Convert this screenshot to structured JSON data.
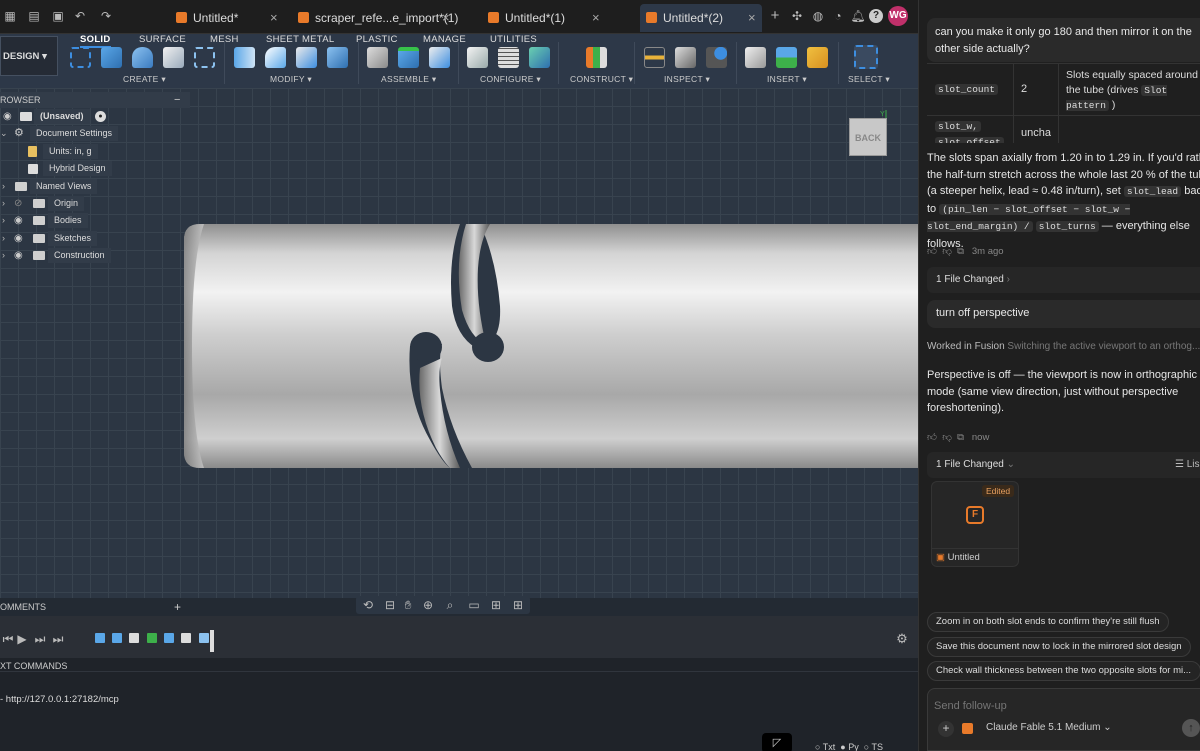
{
  "tabs": [
    {
      "label": "Untitled*"
    },
    {
      "label": "scraper_refe...e_import*(1)"
    },
    {
      "label": "Untitled*(1)"
    },
    {
      "label": "Untitled*(2)"
    }
  ],
  "user_initials": "WG",
  "ribbon": {
    "workspace": "DESIGN",
    "tabs": [
      "SOLID",
      "SURFACE",
      "MESH",
      "SHEET METAL",
      "PLASTIC",
      "MANAGE",
      "UTILITIES"
    ],
    "groups": [
      "CREATE",
      "MODIFY",
      "ASSEMBLE",
      "CONFIGURE",
      "CONSTRUCT",
      "INSPECT",
      "INSERT",
      "SELECT"
    ]
  },
  "browser": {
    "title": "ROWSER",
    "items": [
      {
        "label": "(Unsaved)"
      },
      {
        "label": "Document Settings"
      },
      {
        "label": "Units: in, g"
      },
      {
        "label": "Hybrid Design"
      },
      {
        "label": "Named Views"
      },
      {
        "label": "Origin"
      },
      {
        "label": "Bodies"
      },
      {
        "label": "Sketches"
      },
      {
        "label": "Construction"
      }
    ]
  },
  "viewcube_label": "BACK",
  "comments_label": "OMMENTS",
  "text_commands": {
    "header": "XT COMMANDS",
    "line": "- http://127.0.0.1:27182/mcp"
  },
  "status_labels": [
    "Txt",
    "Py",
    "TS"
  ],
  "chat": {
    "user_message_1": "can you make it only go 180 and then mirror it on the other side actually?",
    "table": [
      {
        "param": "slot_count",
        "value": "2",
        "desc_pre": "Slots equally spaced around the tube (drives",
        "desc_code": "Slot pattern",
        "desc_post": ")"
      },
      {
        "param": "slot_w,",
        "value": "uncha",
        "desc_pre": "",
        "desc_code": "",
        "desc_post": ""
      }
    ],
    "table_param_2b": "slot_offset",
    "paragraph": {
      "t1": "The slots span axially from 1.20 in to 1.29 in. If you'd rather the half-turn stretch across the whole last 20 % of the tube (a steeper helix, lead ≈ 0.48 in/turn), set",
      "c1": "slot_lead",
      "t2": "back to",
      "c2": "(pin_len − slot_offset − slot_w − slot_end_margin) /",
      "c3": "slot_turns",
      "t3": "— everything else follows."
    },
    "time_1": "3m ago",
    "files_changed_1": "1 File Changed",
    "user_message_2": "turn off perspective",
    "worked_label": "Worked in Fusion",
    "worked_detail": "Switching the active viewport to an orthog...",
    "reply_2": "Perspective is off — the viewport is now in orthographic mode (same view direction, just without perspective foreshortening).",
    "time_2": "now",
    "files_changed_2": "1 File Changed",
    "list_label": "Lis",
    "file_card": {
      "badge": "Edited",
      "name": "Untitled"
    },
    "suggestions": [
      "Zoom in on both slot ends to confirm they're still flush",
      "Save this document now to lock in the mirrored slot design",
      "Check wall thickness between the two opposite slots for mi..."
    ],
    "input_placeholder": "Send follow-up",
    "model": "Claude Fable 5.1 Medium"
  },
  "colors": {
    "accent_blue": "#3d8ee0",
    "fusion_orange": "#e87a2a",
    "avatar": "#c0306a",
    "viewport_bg": "#2c3643"
  }
}
